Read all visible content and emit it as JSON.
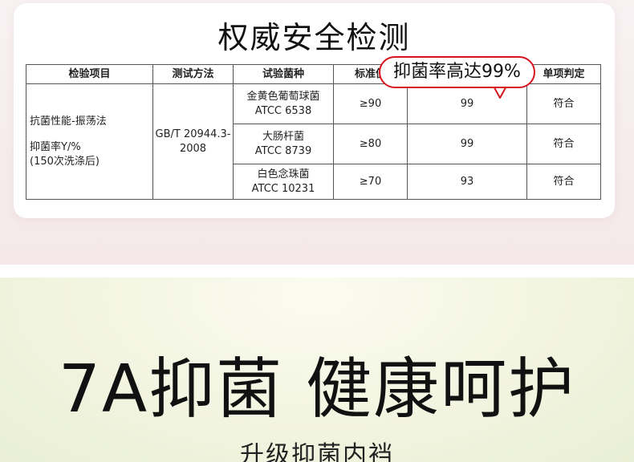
{
  "card": {
    "title": "权威安全检测",
    "callout": "抑菌率高达99%"
  },
  "table": {
    "headers": [
      "检验项目",
      "测试方法",
      "试验菌种",
      "标准值",
      "",
      "单项判定"
    ],
    "item": {
      "line1": "抗菌性能-振荡法",
      "line2": "抑菌率Y/%",
      "line3": "(150次洗涤后)"
    },
    "method": "GB/T 20944.3-2008",
    "rows": [
      {
        "strain": "金黄色葡萄球菌",
        "code": "ATCC 6538",
        "standard": "≥90",
        "result": "99",
        "verdict": "符合"
      },
      {
        "strain": "大肠杆菌",
        "code": "ATCC 8739",
        "standard": "≥80",
        "result": "99",
        "verdict": "符合"
      },
      {
        "strain": "白色念珠菌",
        "code": "ATCC 10231",
        "standard": "≥70",
        "result": "93",
        "verdict": "符合"
      }
    ]
  },
  "banner": {
    "headline_a": "7A抑菌",
    "headline_b": "健康呵护",
    "subline": "升级抑菌内裆"
  },
  "colors": {
    "callout_border": "#d8141f",
    "table_border": "#555555"
  }
}
